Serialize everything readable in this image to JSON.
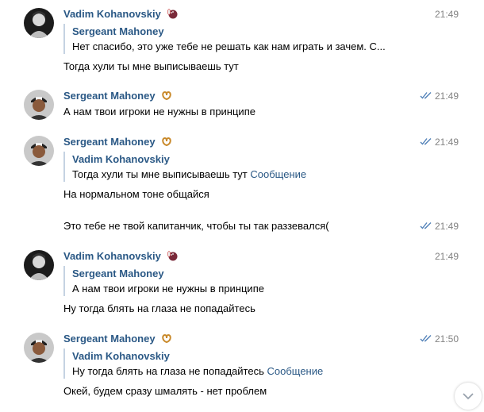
{
  "messages": [
    {
      "author": "Vadim Kohanovskiy",
      "emoji_icon": "bowling-icon",
      "time": "21:49",
      "read": false,
      "reply": {
        "author": "Sergeant Mahoney",
        "text": "Нет спасибо, это уже тебе не решать как нам играть и зачем. С...",
        "link": ""
      },
      "text": "Тогда хули ты мне выписываешь тут"
    },
    {
      "author": "Sergeant Mahoney",
      "emoji_icon": "pretzel-icon",
      "time": "21:49",
      "read": true,
      "text": "А нам твои игроки не нужны в принципе"
    },
    {
      "author": "Sergeant Mahoney",
      "emoji_icon": "pretzel-icon",
      "time": "21:49",
      "read": true,
      "reply": {
        "author": "Vadim Kohanovskiy",
        "text": "Тогда хули ты мне выписываешь тут ",
        "link": "Сообщение"
      },
      "text": "На нормальном тоне общайся",
      "followup": {
        "text": "Это тебе не твой капитанчик, чтобы ты так раззевался(",
        "time": "21:49",
        "read": true
      }
    },
    {
      "author": "Vadim Kohanovskiy",
      "emoji_icon": "bowling-icon",
      "time": "21:49",
      "read": false,
      "reply": {
        "author": "Sergeant Mahoney",
        "text": "А нам твои игроки не нужны в принципе",
        "link": ""
      },
      "text": "Ну тогда блять на глаза не попадайтесь"
    },
    {
      "author": "Sergeant Mahoney",
      "emoji_icon": "pretzel-icon",
      "time": "21:50",
      "read": true,
      "reply": {
        "author": "Vadim Kohanovskiy",
        "text": "Ну тогда блять на глаза не попадайтесь ",
        "link": "Сообщение"
      },
      "text": "Окей, будем сразу шмалять - нет проблем"
    }
  ],
  "scroll_button_icon": "chevron-down-icon",
  "colors": {
    "name": "#2a5885",
    "time": "#828282",
    "quote_border": "#c5d3e2",
    "ticks": "#5181b8"
  }
}
